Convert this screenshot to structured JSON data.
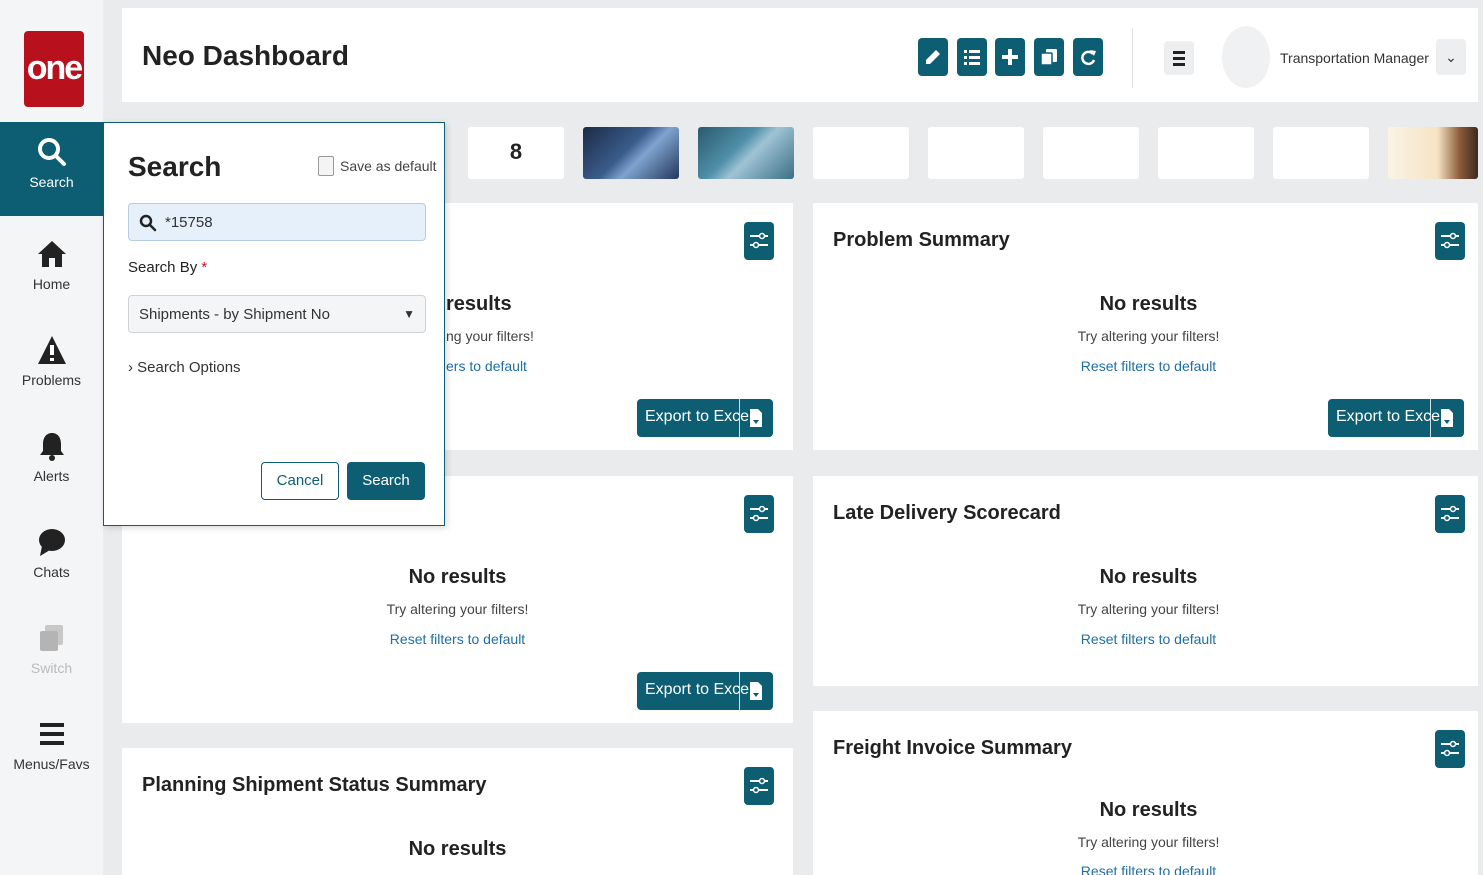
{
  "app": {
    "logo_text": "one",
    "brand_color": "#b8101d",
    "accent_color": "#0d5e72"
  },
  "nav": {
    "items": [
      {
        "label": "Search",
        "icon": "search-icon",
        "active": true
      },
      {
        "label": "Home",
        "icon": "home-icon"
      },
      {
        "label": "Problems",
        "icon": "warning-icon"
      },
      {
        "label": "Alerts",
        "icon": "bell-icon"
      },
      {
        "label": "Chats",
        "icon": "chat-icon"
      },
      {
        "label": "Switch",
        "icon": "switch-icon",
        "disabled": true
      },
      {
        "label": "Menus/Favs",
        "icon": "menu-icon"
      }
    ]
  },
  "header": {
    "title": "Neo Dashboard",
    "toolbar_icons": [
      "edit-icon",
      "list-icon",
      "plus-icon",
      "copy-icon",
      "refresh-icon"
    ],
    "user_role": "Transportation Manager"
  },
  "tiles": {
    "count_value": "8"
  },
  "search_panel": {
    "title": "Search",
    "save_default_label": "Save as default",
    "query_value": "*15758",
    "search_by_label": "Search By",
    "required_mark": "*",
    "search_by_value": "Shipments - by Shipment No",
    "options_label": "Search Options",
    "cancel_label": "Cancel",
    "search_label": "Search"
  },
  "cards": {
    "no_results": "No results",
    "no_results_partial": "results",
    "try_altering": "Try altering your filters!",
    "try_altering_partial": "ng your filters!",
    "reset": "Reset filters to default",
    "reset_partial": "ers to default",
    "export": "Export to Excel",
    "problem_summary": "Problem Summary",
    "late_delivery": "Late Delivery Scorecard",
    "freight_invoice": "Freight Invoice Summary",
    "planning_shipment": "Planning Shipment Status Summary"
  }
}
